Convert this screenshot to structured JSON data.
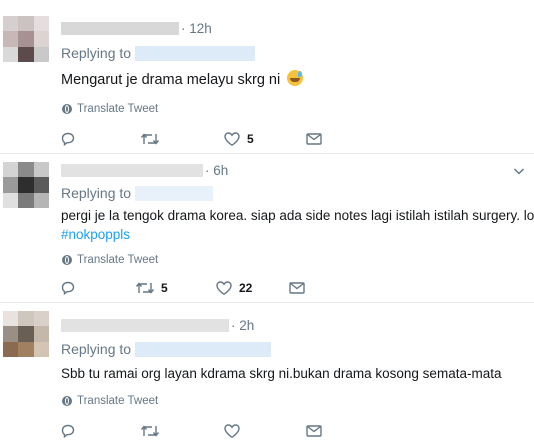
{
  "tweets": [
    {
      "time": "· 12h",
      "replying_to": "Replying to",
      "text": "Mengarut je drama melayu skrg ni",
      "translate": "Translate Tweet",
      "counts": {
        "reply": "",
        "retweet": "",
        "like": "5"
      },
      "avatar_colors": [
        "#d6cfcf",
        "#cbc2c1",
        "#e4dede",
        "#c7b7b6",
        "#a89291",
        "#dcd4d3",
        "#d9d9d9",
        "#5c4b4a",
        "#c9c9c9"
      ]
    },
    {
      "time": "· 6h",
      "replying_to": "Replying to",
      "handle_prefix": "(",
      "text": "pergi je la tengok drama korea. siap ada side notes lagi istilah istilah surgery. lol.",
      "hashtag": "#nokpoppls",
      "translate": "Translate Tweet",
      "counts": {
        "reply": "",
        "retweet": "5",
        "like": "22"
      },
      "avatar_colors": [
        "#d4d4d4",
        "#8a8a8a",
        "#c8c8c8",
        "#9a9a9a",
        "#2e2e2e",
        "#5b5b5b",
        "#e0e0e0",
        "#7b7b7b",
        "#b5b5b5"
      ]
    },
    {
      "time": "· 2h",
      "replying_to": "Replying to",
      "text": "Sbb tu ramai org layan kdrama skrg ni.bukan drama kosong semata-mata",
      "translate": "Translate Tweet",
      "counts": {
        "reply": "",
        "retweet": "",
        "like": ""
      },
      "avatar_colors": [
        "#e8e3de",
        "#cfc7be",
        "#d9d1c9",
        "#9a8f84",
        "#6a5f55",
        "#c4b8ab",
        "#8a6b4f",
        "#a08060",
        "#d3c4b3"
      ]
    }
  ],
  "colors": {
    "link": "#1da1f2",
    "muted": "#657786",
    "text": "#14171a",
    "border": "#e6ecf0"
  },
  "icons": {
    "reply": "reply-icon",
    "retweet": "retweet-icon",
    "like": "heart-icon",
    "dm": "envelope-icon",
    "more": "chevron-down-icon",
    "translate": "globe-icon"
  }
}
